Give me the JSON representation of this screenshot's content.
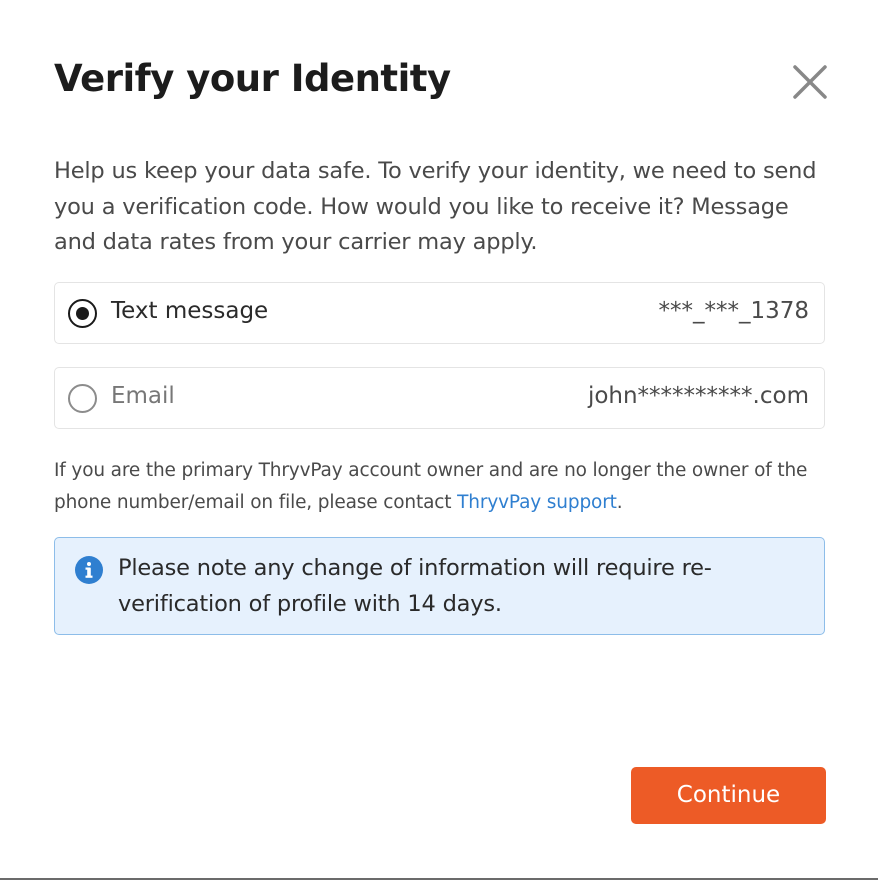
{
  "dialog": {
    "title": "Verify your Identity",
    "close_icon": "close-icon",
    "intro": "Help us keep your data safe. To verify your identity, we need to send you a verification code. How would you like to receive it? Message and data rates from your carrier may apply."
  },
  "options": [
    {
      "label": "Text message",
      "value": "***_***_1378",
      "selected": true
    },
    {
      "label": "Email",
      "value": "john**********.com",
      "selected": false
    }
  ],
  "notice": {
    "text": "If you are the primary ThryvPay account owner and are no longer the owner of the phone number/email on file, please contact ",
    "link_text": "ThryvPay support",
    "suffix": "."
  },
  "info_box": {
    "icon": "info-icon",
    "text": "Please note any change of information will require re-verification of profile with 14 days."
  },
  "footer": {
    "continue_label": "Continue"
  },
  "colors": {
    "accent": "#ed5b26",
    "link": "#2f7fd0",
    "info_bg": "#e6f1fd",
    "info_border": "#8dbde9",
    "info_icon": "#2f7fd0"
  }
}
